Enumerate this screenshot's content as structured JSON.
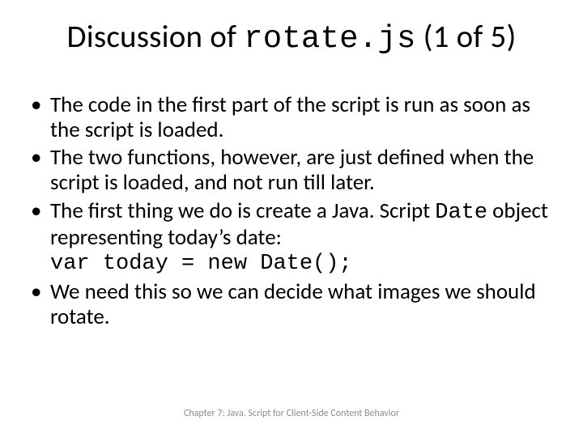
{
  "title": {
    "prefix": "Discussion of ",
    "code": "rotate.js",
    "suffix": " (1 of 5)"
  },
  "bullets": [
    {
      "segments": [
        {
          "t": "The code in the first part of the script is run as soon as the script is loaded."
        }
      ]
    },
    {
      "segments": [
        {
          "t": "The two functions, however, are just defined when the script is loaded, and not run till later."
        }
      ]
    },
    {
      "segments": [
        {
          "t": "The first thing we do is create a Java. Script "
        },
        {
          "t": "Date",
          "code": true
        },
        {
          "t": " object representing today’s date:"
        },
        {
          "br": true
        },
        {
          "t": "var today = new Date();",
          "code": true
        }
      ]
    },
    {
      "segments": [
        {
          "t": "We need this so we can decide what images we should rotate."
        }
      ]
    }
  ],
  "footer": "Chapter 7: Java. Script for Client-Side Content Behavior"
}
